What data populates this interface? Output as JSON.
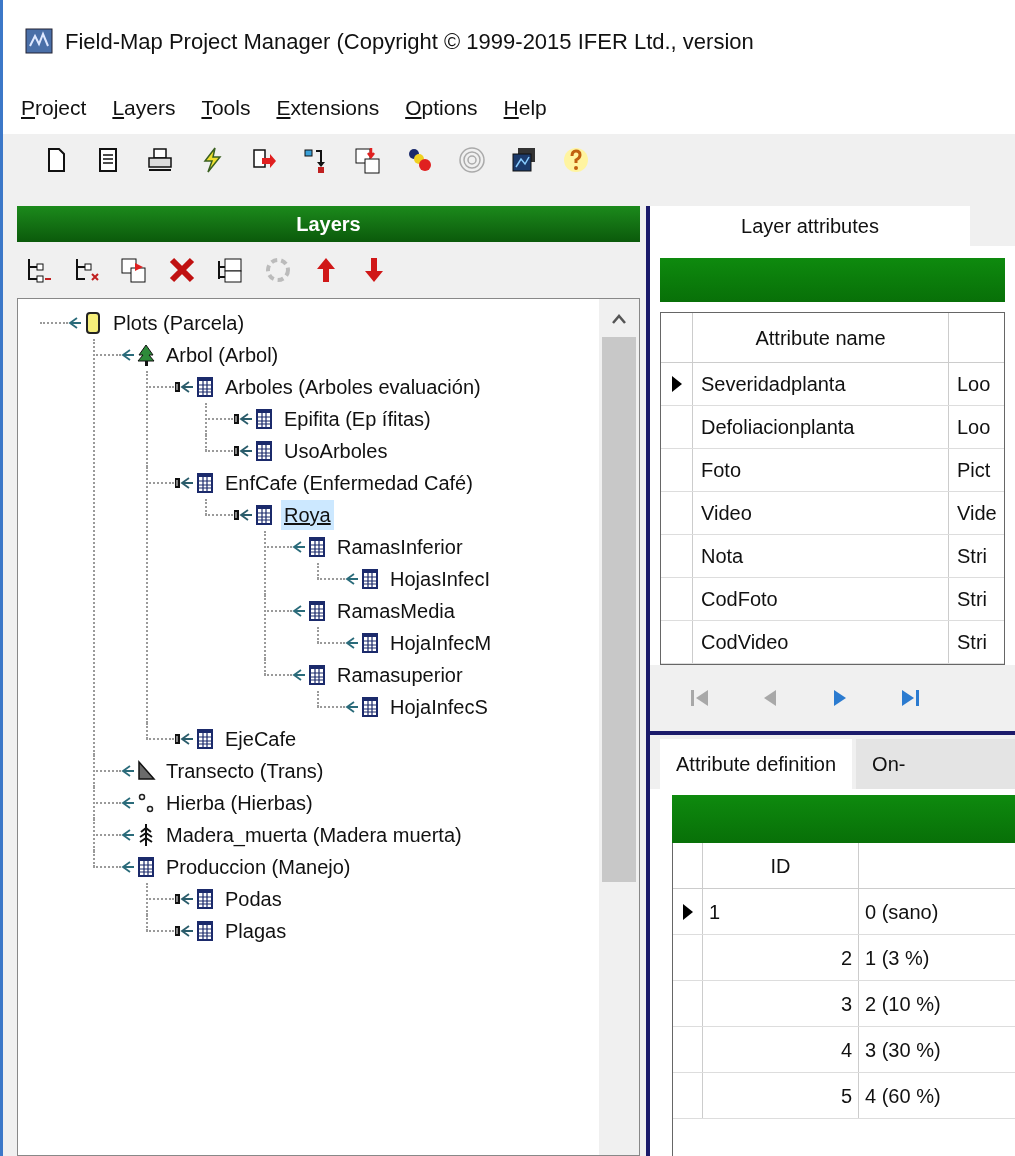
{
  "window": {
    "title": "Field-Map Project Manager (Copyright © 1999-2015 IFER Ltd., version"
  },
  "menu": [
    "Project",
    "Layers",
    "Tools",
    "Extensions",
    "Options",
    "Help"
  ],
  "layers_panel": {
    "title": "Layers"
  },
  "tree": [
    {
      "label": "Plots (Parcela)",
      "kind": "plot",
      "linked": false,
      "selected": false,
      "children": [
        {
          "label": "Arbol (Arbol)",
          "kind": "tree",
          "linked": false,
          "selected": false,
          "children": [
            {
              "label": "Arboles (Arboles evaluación)",
              "kind": "table",
              "linked": true,
              "selected": false,
              "children": [
                {
                  "label": "Epifita (Ep ífitas)",
                  "kind": "table",
                  "linked": true,
                  "selected": false
                },
                {
                  "label": "UsoArboles",
                  "kind": "table",
                  "linked": true,
                  "selected": false
                }
              ]
            },
            {
              "label": "EnfCafe (Enfermedad Café)",
              "kind": "table",
              "linked": true,
              "selected": false,
              "children": [
                {
                  "label": "Roya",
                  "kind": "table",
                  "linked": true,
                  "selected": true,
                  "children": [
                    {
                      "label": "RamasInferior",
                      "kind": "table",
                      "linked": false,
                      "selected": false,
                      "children": [
                        {
                          "label": "HojasInfecI",
                          "kind": "table",
                          "linked": false,
                          "selected": false
                        }
                      ]
                    },
                    {
                      "label": "RamasMedia",
                      "kind": "table",
                      "linked": false,
                      "selected": false,
                      "children": [
                        {
                          "label": "HojaInfecM",
                          "kind": "table",
                          "linked": false,
                          "selected": false
                        }
                      ]
                    },
                    {
                      "label": "Ramasuperior",
                      "kind": "table",
                      "linked": false,
                      "selected": false,
                      "children": [
                        {
                          "label": "HojaInfecS",
                          "kind": "table",
                          "linked": false,
                          "selected": false
                        }
                      ]
                    }
                  ]
                }
              ]
            },
            {
              "label": "EjeCafe",
              "kind": "table",
              "linked": true,
              "selected": false
            }
          ]
        },
        {
          "label": "Transecto (Trans)",
          "kind": "transect",
          "linked": false,
          "selected": false
        },
        {
          "label": "Hierba (Hierbas)",
          "kind": "points",
          "linked": false,
          "selected": false
        },
        {
          "label": "Madera_muerta (Madera muerta)",
          "kind": "deadwood",
          "linked": false,
          "selected": false
        },
        {
          "label": "Produccion (Manejo)",
          "kind": "table",
          "linked": false,
          "selected": false,
          "children": [
            {
              "label": "Podas",
              "kind": "table",
              "linked": true,
              "selected": false
            },
            {
              "label": "Plagas",
              "kind": "table",
              "linked": true,
              "selected": false
            }
          ]
        }
      ]
    }
  ],
  "top_tabs": [
    {
      "label": "Layer attributes",
      "selected": true
    }
  ],
  "attributes_grid": {
    "columns": [
      "Attribute name"
    ],
    "rows": [
      {
        "selected": true,
        "attribute_name": "Severidadplanta",
        "column_2": "Loo"
      },
      {
        "selected": false,
        "attribute_name": "Defoliacionplanta",
        "column_2": "Loo"
      },
      {
        "selected": false,
        "attribute_name": "Foto",
        "column_2": "Pict"
      },
      {
        "selected": false,
        "attribute_name": "Video",
        "column_2": "Vide"
      },
      {
        "selected": false,
        "attribute_name": "Nota",
        "column_2": "Stri"
      },
      {
        "selected": false,
        "attribute_name": "CodFoto",
        "column_2": "Stri"
      },
      {
        "selected": false,
        "attribute_name": "CodVideo",
        "column_2": "Stri"
      }
    ]
  },
  "navigator": [
    {
      "kind": "first",
      "disabled": true
    },
    {
      "kind": "prior",
      "disabled": true
    },
    {
      "kind": "next",
      "disabled": false
    },
    {
      "kind": "last",
      "disabled": false
    }
  ],
  "bottom_tabs": [
    {
      "label": "Attribute definition",
      "selected": true
    },
    {
      "label": "On-",
      "selected": false
    }
  ],
  "values_grid": {
    "columns": [
      "ID"
    ],
    "rows": [
      {
        "selected": true,
        "id": "1",
        "column_2": "0 (sano)"
      },
      {
        "selected": false,
        "id": "2",
        "column_2": "1 (3 %)"
      },
      {
        "selected": false,
        "id": "3",
        "column_2": "2 (10 %)"
      },
      {
        "selected": false,
        "id": "4",
        "column_2": "3 (30 %)"
      },
      {
        "selected": false,
        "id": "5",
        "column_2": "4 (60 %)"
      }
    ]
  }
}
